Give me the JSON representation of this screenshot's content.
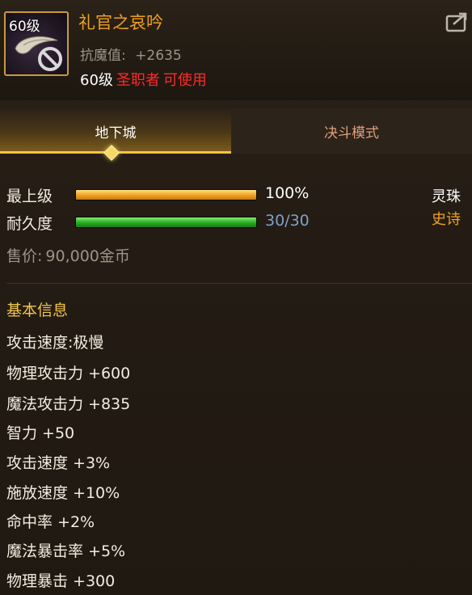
{
  "item": {
    "level_badge": "60级",
    "name": "礼官之哀吟",
    "resist_label": "抗魔值:",
    "resist_value": "+2635",
    "req_level": "60级",
    "req_class": "圣职者",
    "req_usable": "可使用"
  },
  "tabs": [
    {
      "label": "地下城",
      "active": true
    },
    {
      "label": "决斗模式",
      "active": false
    }
  ],
  "grade": {
    "label": "最上级",
    "percent": 100,
    "value_text": "100%"
  },
  "durability": {
    "label": "耐久度",
    "current": 30,
    "max": 30,
    "value_text": "30/30"
  },
  "side": {
    "type_label": "灵珠",
    "rarity_label": "史诗"
  },
  "price": {
    "label": "售价:",
    "value": "90,000金币"
  },
  "basic_info": {
    "title": "基本信息",
    "stats": [
      "攻击速度:极慢",
      "物理攻击力 +600",
      "魔法攻击力 +835",
      "智力 +50",
      "攻击速度 +3%",
      "施放速度 +10%",
      "命中率 +2%",
      "魔法暴击率 +5%",
      "物理暴击 +300"
    ]
  },
  "colors": {
    "item_name": "#f0a11c",
    "class_req": "#ff2a2a",
    "rarity": "#f0a11c",
    "durability_text": "#7fa0c8",
    "section_title": "#f0c54a"
  }
}
